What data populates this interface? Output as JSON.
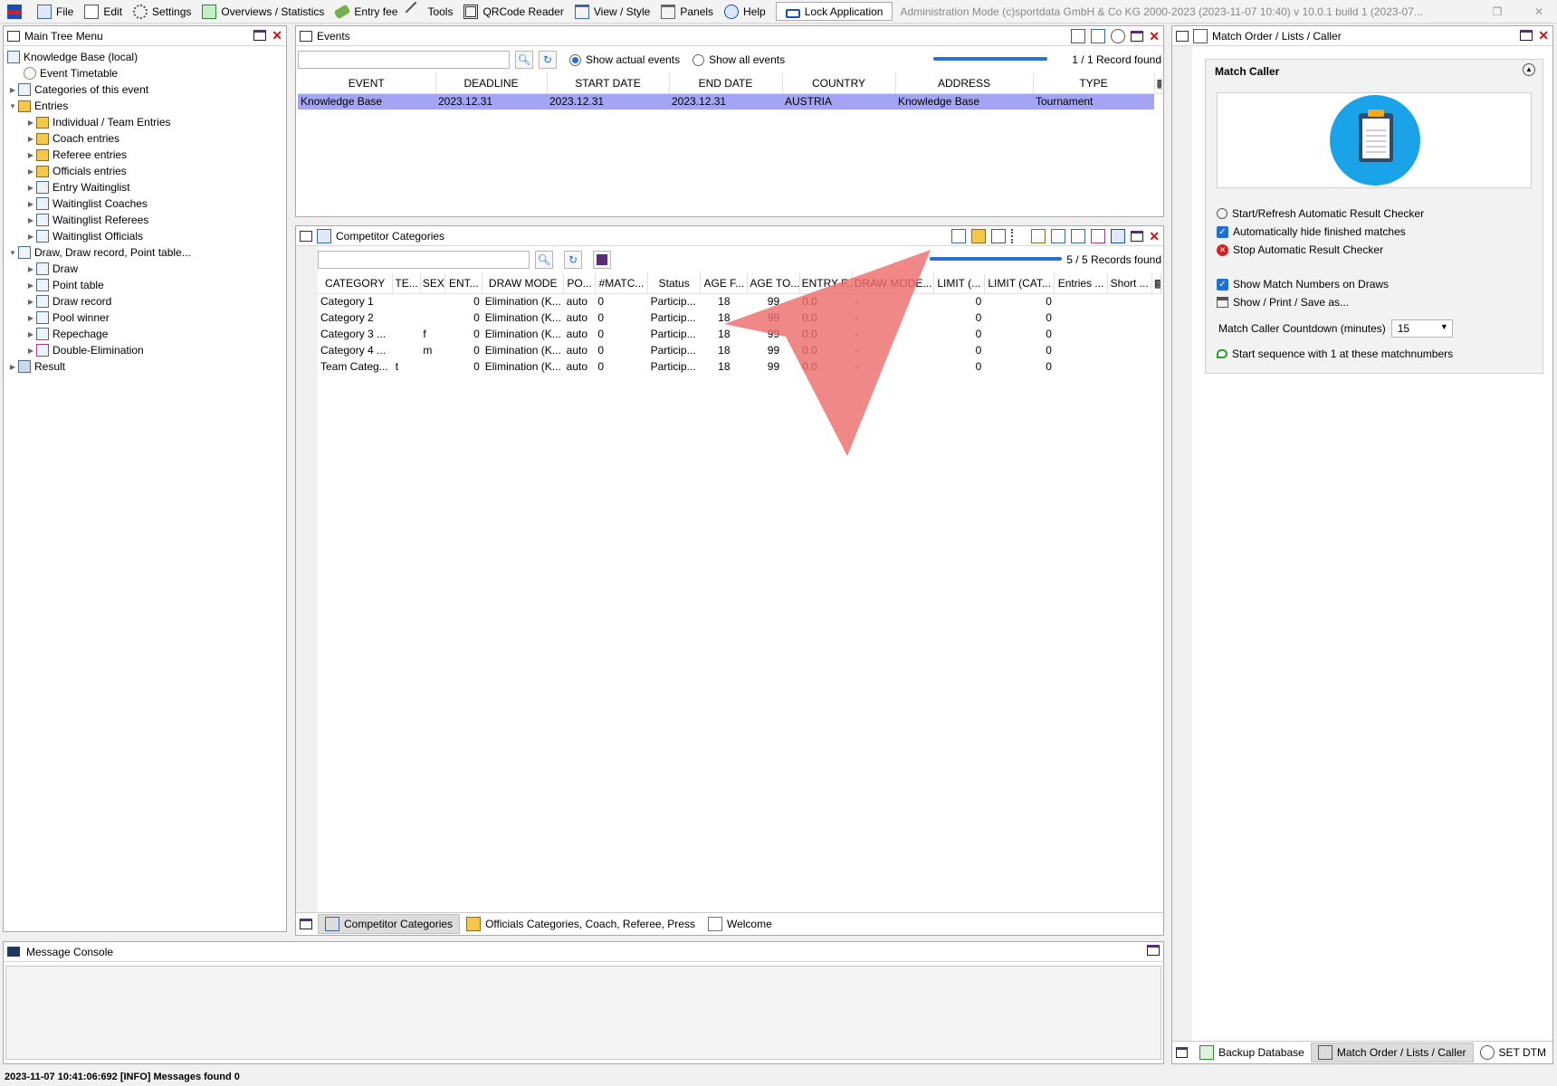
{
  "menubar": {
    "items": [
      "File",
      "Edit",
      "Settings",
      "Overviews / Statistics",
      "Entry fee",
      "Tools",
      "QRCode Reader",
      "View / Style",
      "Panels",
      "Help"
    ],
    "lock_label": "Lock Application",
    "title": "Administration Mode (c)sportdata GmbH & Co KG 2000-2023 (2023-11-07 10:40)  v 10.0.1 build 1 (2023-07..."
  },
  "tree": {
    "title": "Main Tree Menu",
    "items": [
      {
        "label": "Knowledge Base (local)"
      },
      {
        "label": "Event Timetable"
      },
      {
        "label": "Categories of this event"
      },
      {
        "label": "Entries"
      },
      {
        "label": "Individual / Team Entries"
      },
      {
        "label": "Coach entries"
      },
      {
        "label": "Referee entries"
      },
      {
        "label": "Officials entries"
      },
      {
        "label": "Entry Waitinglist"
      },
      {
        "label": "Waitinglist Coaches"
      },
      {
        "label": "Waitinglist Referees"
      },
      {
        "label": "Waitinglist Officials"
      },
      {
        "label": "Draw, Draw record, Point table..."
      },
      {
        "label": "Draw"
      },
      {
        "label": "Point table"
      },
      {
        "label": "Draw record"
      },
      {
        "label": "Pool winner"
      },
      {
        "label": "Repechage"
      },
      {
        "label": "Double-Elimination"
      },
      {
        "label": "Result"
      }
    ]
  },
  "events": {
    "title": "Events",
    "radio_actual": "Show actual events",
    "radio_all": "Show all events",
    "record_count": "1 / 1 Record found",
    "columns": [
      "EVENT",
      "DEADLINE",
      "START DATE",
      "END DATE",
      "COUNTRY",
      "ADDRESS",
      "TYPE"
    ],
    "rows": [
      [
        "Knowledge Base",
        "2023.12.31",
        "2023.12.31",
        "2023.12.31",
        "AUSTRIA",
        "Knowledge Base",
        "Tournament"
      ]
    ]
  },
  "categories": {
    "title": "Competitor Categories",
    "record_count": "5 / 5 Records found",
    "columns": [
      "CATEGORY",
      "TE...",
      "SEX",
      "ENT...",
      "DRAW MODE",
      "PO...",
      "#MATC...",
      "Status",
      "AGE F...",
      "AGE TO...",
      "ENTRY F...",
      "DRAW MODE...",
      "LIMIT (...",
      "LIMIT (CAT...",
      "Entries ...",
      "Short ..."
    ],
    "rows": [
      [
        "Category 1",
        "",
        "",
        "0",
        "Elimination (K...",
        "auto",
        "0",
        "Particip...",
        "18",
        "99",
        "0.0",
        "-",
        "0",
        "0",
        "",
        ""
      ],
      [
        "Category 2",
        "",
        "",
        "0",
        "Elimination (K...",
        "auto",
        "0",
        "Particip...",
        "18",
        "99",
        "0.0",
        "-",
        "0",
        "0",
        "",
        ""
      ],
      [
        "Category 3 ...",
        "",
        "f",
        "0",
        "Elimination (K...",
        "auto",
        "0",
        "Particip...",
        "18",
        "99",
        "0.0",
        "-",
        "0",
        "0",
        "",
        ""
      ],
      [
        "Category 4 ...",
        "",
        "m",
        "0",
        "Elimination (K...",
        "auto",
        "0",
        "Particip...",
        "18",
        "99",
        "0.0",
        "-",
        "0",
        "0",
        "",
        ""
      ],
      [
        "Team Categ...",
        "t",
        "",
        "0",
        "Elimination (K...",
        "auto",
        "0",
        "Particip...",
        "18",
        "99",
        "0.0",
        "-",
        "0",
        "0",
        "",
        ""
      ]
    ],
    "tabs": [
      "Competitor Categories",
      "Officials Categories, Coach, Referee, Press",
      "Welcome"
    ]
  },
  "match_caller": {
    "panel_title": "Match Order / Lists / Caller",
    "section_title": "Match Caller",
    "items": {
      "start_refresh": "Start/Refresh Automatic Result Checker",
      "auto_hide": "Automatically hide finished matches",
      "stop": "Stop Automatic Result Checker",
      "show_numbers": "Show Match Numbers on Draws",
      "show_print": "Show / Print / Save as...",
      "countdown_label": "Match Caller Countdown (minutes)",
      "countdown_value": "15",
      "start_sequence": "Start sequence with 1 at these matchnumbers"
    },
    "tabs": [
      "Backup Database",
      "Match Order / Lists / Caller",
      "SET DTM"
    ]
  },
  "console": {
    "title": "Message Console"
  },
  "status": {
    "text": "2023-11-07 10:41:06:692 [INFO] Messages found 0"
  },
  "colors": {
    "selection": "#a4a4f4",
    "accent_blue": "#1f6fd1",
    "close_red": "#d01010",
    "arrow": "#ee6e6e"
  }
}
